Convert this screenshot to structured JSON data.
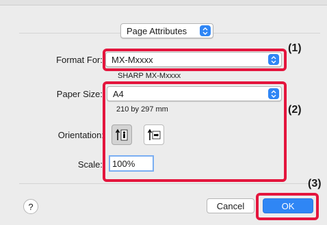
{
  "header": {
    "page_attributes_label": "Page Attributes"
  },
  "format_for": {
    "label": "Format For:",
    "value": "MX-Mxxxx",
    "printer_description": "SHARP MX-Mxxxx"
  },
  "paper_size": {
    "label": "Paper Size:",
    "value": "A4",
    "dimensions": "210 by 297 mm"
  },
  "orientation": {
    "label": "Orientation:",
    "options": [
      "portrait",
      "landscape"
    ],
    "selected": "portrait"
  },
  "scale": {
    "label": "Scale:",
    "value": "100%"
  },
  "buttons": {
    "help": "?",
    "cancel": "Cancel",
    "ok": "OK"
  },
  "callouts": {
    "c1": "(1)",
    "c2": "(2)",
    "c3": "(3)"
  },
  "colors": {
    "accent": "#2f86f5",
    "highlight": "#e4153d"
  },
  "icons": {
    "stepper": "chevron-up-down-icon",
    "portrait": "portrait-person-icon",
    "landscape": "landscape-person-icon"
  }
}
